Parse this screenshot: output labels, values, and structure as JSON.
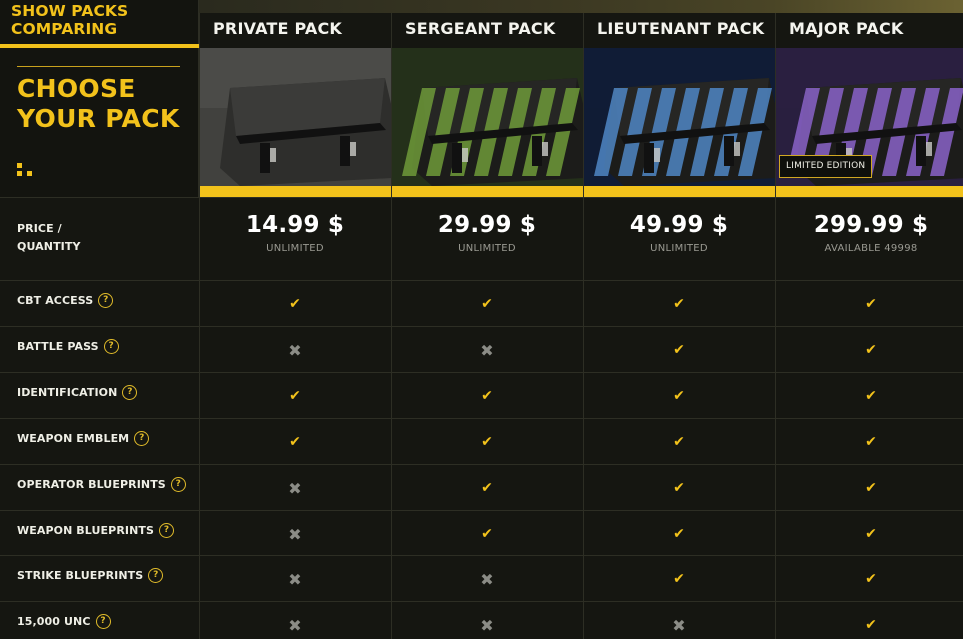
{
  "header": {
    "show_packs": "SHOW PACKS COMPARING",
    "choose_title": "CHOOSE YOUR PACK"
  },
  "packs": [
    {
      "name": "PRIVATE PACK",
      "price": "14.99 $",
      "quantity": "UNLIMITED",
      "color": "#5a5a58",
      "badge": ""
    },
    {
      "name": "SERGEANT PACK",
      "price": "29.99 $",
      "quantity": "UNLIMITED",
      "color": "#6f9a3a",
      "badge": ""
    },
    {
      "name": "LIEUTENANT PACK",
      "price": "49.99 $",
      "quantity": "UNLIMITED",
      "color": "#4f86c4",
      "badge": ""
    },
    {
      "name": "MAJOR PACK",
      "price": "299.99 $",
      "quantity": "AVAILABLE 49998",
      "color": "#8a63c9",
      "badge": "LIMITED EDITION"
    }
  ],
  "price_row_label": "PRICE / QUANTITY",
  "features": [
    {
      "label": "CBT ACCESS",
      "values": [
        true,
        true,
        true,
        true
      ]
    },
    {
      "label": "BATTLE PASS",
      "values": [
        false,
        false,
        true,
        true
      ]
    },
    {
      "label": "IDENTIFICATION",
      "values": [
        true,
        true,
        true,
        true
      ]
    },
    {
      "label": "WEAPON EMBLEM",
      "values": [
        true,
        true,
        true,
        true
      ]
    },
    {
      "label": "OPERATOR BLUEPRINTS",
      "values": [
        false,
        true,
        true,
        true
      ]
    },
    {
      "label": "WEAPON BLUEPRINTS",
      "values": [
        false,
        true,
        true,
        true
      ]
    },
    {
      "label": "STRIKE BLUEPRINTS",
      "values": [
        false,
        false,
        true,
        true
      ]
    },
    {
      "label": "15,000 UNC",
      "values": [
        false,
        false,
        false,
        true
      ]
    }
  ],
  "icons": {
    "check": "check-icon",
    "cross": "cross-icon",
    "help": "question-icon"
  },
  "colors": {
    "accent": "#f2c21b",
    "background": "#151611",
    "cross": "#8b8c86"
  }
}
